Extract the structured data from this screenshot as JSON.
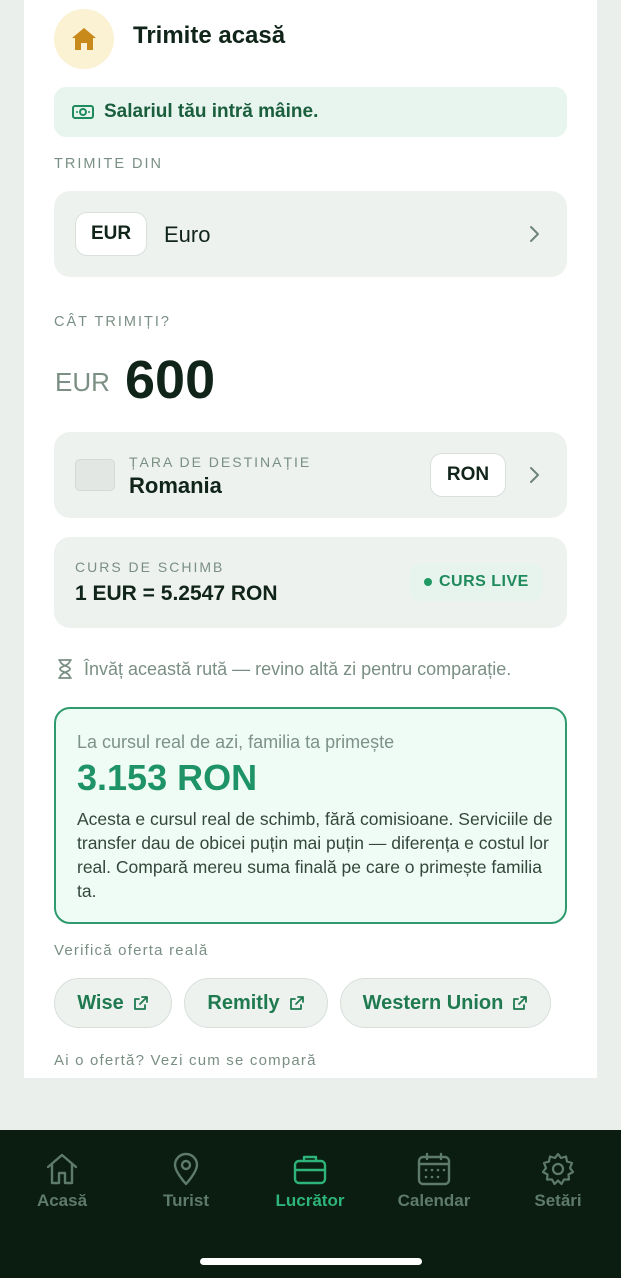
{
  "header": {
    "title": "Trimite acasă",
    "icon": "home-icon"
  },
  "banner": {
    "text": "Salariul tău intră mâine.",
    "icon": "money-icon"
  },
  "send_from": {
    "label": "TRIMITE DIN",
    "currency_code": "EUR",
    "currency_name": "Euro"
  },
  "amount": {
    "label": "CÂT TRIMIȚI?",
    "currency": "EUR",
    "value": "600"
  },
  "destination": {
    "label": "ȚARA DE DESTINAȚIE",
    "country": "Romania",
    "currency": "RON"
  },
  "exchange": {
    "label": "CURS DE SCHIMB",
    "rate": "1 EUR = 5.2547 RON",
    "live_label": "CURS LIVE"
  },
  "route_note": "Învăț această rută — revino altă zi pentru comparație.",
  "result": {
    "lead": "La cursul real de azi, familia ta primește",
    "value": "3.153 RON",
    "body": "Acesta e cursul real de schimb, fără comisioane. Serviciile de transfer dau de obicei puțin mai puțin — diferența e costul lor real. Compară mereu suma finală pe care o primește familia ta."
  },
  "verify": {
    "label": "Verifică oferta reală",
    "providers": [
      "Wise",
      "Remitly",
      "Western Union"
    ]
  },
  "compare_link": "Ai o ofertă? Vezi cum se compară",
  "nav": {
    "items": [
      {
        "label": "Acasă",
        "icon": "home-icon",
        "active": false
      },
      {
        "label": "Turist",
        "icon": "map-pin-icon",
        "active": false
      },
      {
        "label": "Lucrător",
        "icon": "briefcase-icon",
        "active": true
      },
      {
        "label": "Calendar",
        "icon": "calendar-icon",
        "active": false
      },
      {
        "label": "Setări",
        "icon": "gear-icon",
        "active": false
      }
    ]
  },
  "colors": {
    "accent": "#1e9367",
    "nav_active": "#2eb47a",
    "nav_inactive": "#5e7a68",
    "nav_bg": "#0a1d10",
    "home_icon": "#c98a1c"
  }
}
